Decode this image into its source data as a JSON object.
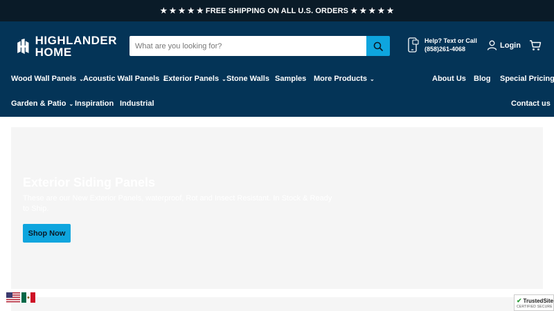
{
  "announcement": "★ ★ ★ ★ ★ FREE SHIPPING ON ALL U.S. ORDERS ★ ★ ★ ★ ★",
  "logo": {
    "line1": "HIGHLANDER",
    "line2": "HOME"
  },
  "search": {
    "placeholder": "What are you looking for?",
    "value": ""
  },
  "help": {
    "line1": "Help? Text or Call",
    "line2": "(858)261-4068"
  },
  "account": {
    "login": "Login"
  },
  "nav": {
    "wood": "Wood Wall Panels",
    "acoustic": "Acoustic Wall Panels",
    "exterior": "Exterior Panels",
    "stone": "Stone Walls",
    "samples": "Samples",
    "more": "More Products",
    "about": "About Us",
    "blog": "Blog",
    "pricing": "Special Pricing",
    "garden": "Garden & Patio",
    "inspiration": "Inspiration",
    "industrial": "Industrial",
    "contact": "Contact us"
  },
  "hero": {
    "title": "Exterior Siding Panels",
    "subtitle": "These are our New Exterior Panels, waterproof, Rot and Insect Resistant. In Stock & Ready to Ship.",
    "button": "Shop Now"
  },
  "trusted": {
    "title": "TrustedSite",
    "sub": "CERTIFIED SECURE"
  },
  "colors": {
    "header": "#043457",
    "topbar": "#0a1b28",
    "accent": "#0ea5de",
    "hero_bg": "#f5f5f5"
  }
}
